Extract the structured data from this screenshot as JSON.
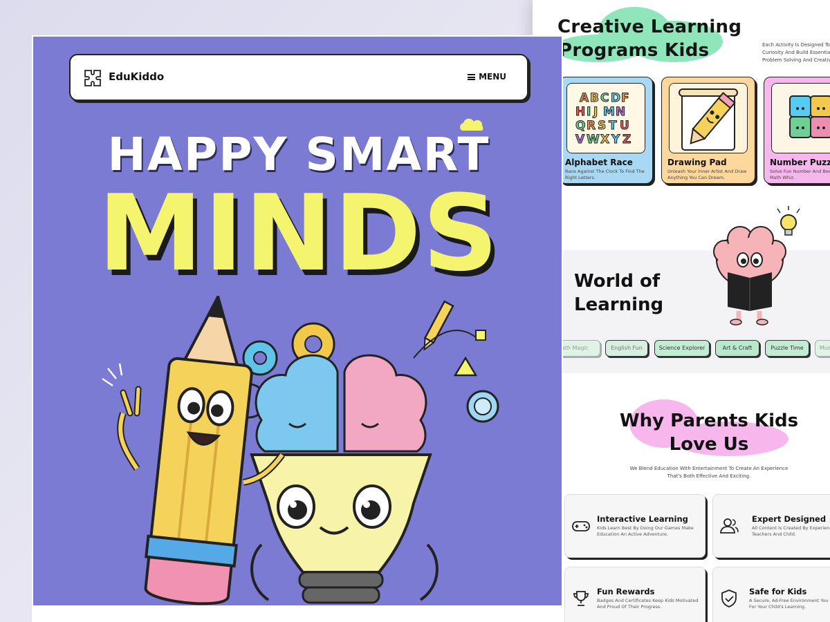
{
  "hero": {
    "brand": "EduKiddo",
    "menu_label": "MENU",
    "headline_top": "HAPPY SMART",
    "headline_main": "MINDS"
  },
  "programs": {
    "title_line1": "Creative Learning",
    "title_line2": "Programs Kids",
    "description": "Each Activity Is Designed To Curiosity And Build Essential Problem Solving And Creative",
    "cards": [
      {
        "title": "Alphabet Race",
        "desc": "Race Against The Clock To Find The Right Letters.",
        "color": "#a9d8f5"
      },
      {
        "title": "Drawing Pad",
        "desc": "Unleash Your Inner Artist And Draw Anything You Can Dream.",
        "color": "#fdd79b"
      },
      {
        "title": "Number Puzzles",
        "desc": "Solve Fun Number And Become A Math Whiz.",
        "color": "#f7b7ec"
      }
    ]
  },
  "world": {
    "title_line1": "World of",
    "title_line2": "Learning",
    "chips": [
      "Math Magic",
      "English Fun",
      "Science Explorer",
      "Art & Craft",
      "Puzzle Time",
      "Music"
    ]
  },
  "why": {
    "title_line1": "Why Parents Kids",
    "title_line2": "Love Us",
    "description": "We Blend Education With Entertainment To Create An Experience That's Both Effective And Exciting.",
    "features": [
      {
        "title": "Interactive Learning",
        "desc": "Kids Learn Best By Doing Our Games Make Education An Active Adventure.",
        "icon": "gamepad-icon"
      },
      {
        "title": "Expert Designed",
        "desc": "All Content Is Created By Experienced Teachers And Child.",
        "icon": "users-icon"
      },
      {
        "title": "Fun Rewards",
        "desc": "Badges And Certificates Keep Kids Motivated And Proud Of Their Progress.",
        "icon": "trophy-icon"
      },
      {
        "title": "Safe for Kids",
        "desc": "A Secure, Ad-Free Environment You Can Trust For Your Child's Learning.",
        "icon": "shield-check-icon"
      }
    ]
  },
  "colors": {
    "hero_bg": "#7b7bd3",
    "minds_yellow": "#f4f46e",
    "chip_green": "#bfeed4",
    "title_blob_green": "#8fe6bb",
    "title_blob_pink": "#f7b7ec"
  }
}
